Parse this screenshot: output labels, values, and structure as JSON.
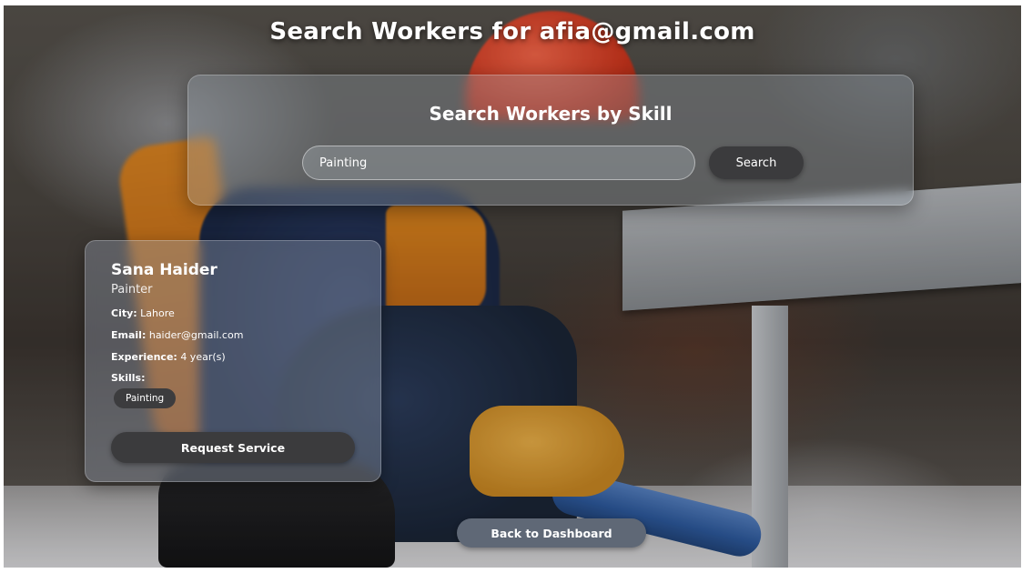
{
  "page": {
    "title": "Search Workers for afia@gmail.com"
  },
  "search": {
    "heading": "Search Workers by Skill",
    "value": "Painting",
    "placeholder": "",
    "button_label": "Search"
  },
  "results": [
    {
      "name": "Sana Haider",
      "role": "Painter",
      "city_label": "City:",
      "city": "Lahore",
      "email_label": "Email:",
      "email": "haider@gmail.com",
      "experience_label": "Experience:",
      "experience": "4 year(s)",
      "skills_label": "Skills:",
      "skills": [
        "Painting"
      ],
      "request_label": "Request Service"
    }
  ],
  "footer": {
    "back_label": "Back to Dashboard"
  },
  "colors": {
    "button_dark": "#3b3b3d",
    "back_button": "#5f6876",
    "text": "#ffffff"
  }
}
